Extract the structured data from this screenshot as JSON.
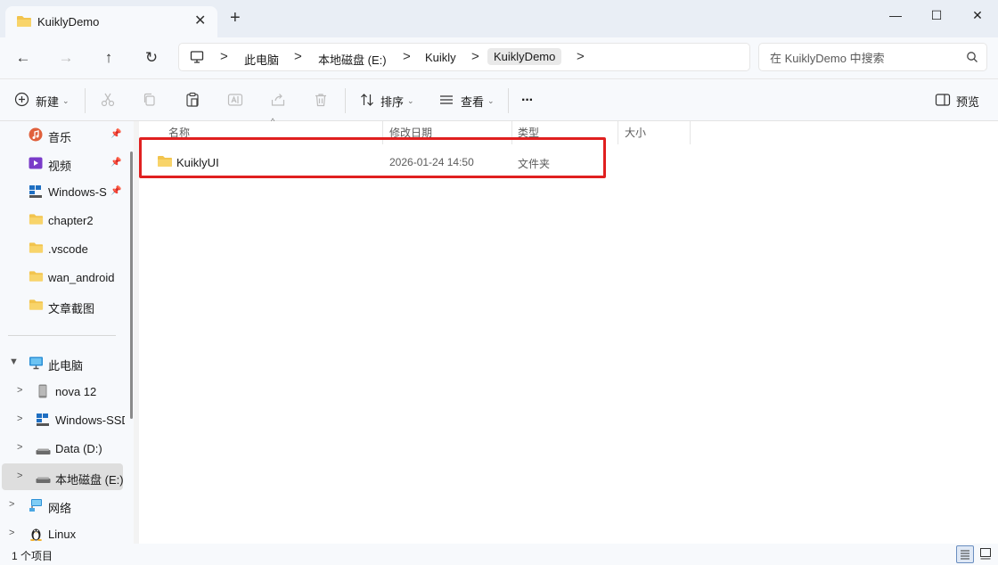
{
  "window": {
    "tab_title": "KuiklyDemo",
    "tab_close": "✕",
    "new_tab": "+",
    "minimize": "—",
    "maximize": "☐",
    "close": "✕"
  },
  "nav": {
    "back": "←",
    "forward": "→",
    "up": "↑",
    "refresh": "↻",
    "breadcrumbs": [
      "此电脑",
      "本地磁盘 (E:)",
      "Kuikly",
      "KuiklyDemo"
    ],
    "separator": ">"
  },
  "search": {
    "placeholder": "在 KuiklyDemo 中搜索"
  },
  "toolbar": {
    "new_label": "新建",
    "sort_label": "排序",
    "view_label": "查看",
    "more_label": "···",
    "preview_label": "预览"
  },
  "sidebar": {
    "quick_access": [
      {
        "label": "音乐",
        "icon": "music-icon",
        "pinned": true
      },
      {
        "label": "视频",
        "icon": "video-icon",
        "pinned": true
      },
      {
        "label": "Windows-SSD",
        "icon": "windows-drive-icon",
        "pinned": true
      },
      {
        "label": "chapter2",
        "icon": "folder-icon"
      },
      {
        "label": ".vscode",
        "icon": "folder-icon"
      },
      {
        "label": "wan_android",
        "icon": "folder-icon"
      },
      {
        "label": "文章截图",
        "icon": "folder-icon"
      }
    ],
    "this_pc": {
      "label": "此电脑",
      "icon": "computer-icon"
    },
    "drives": [
      {
        "label": "nova 12",
        "icon": "phone-icon"
      },
      {
        "label": "Windows-SSD",
        "icon": "windows-drive-icon"
      },
      {
        "label": "Data (D:)",
        "icon": "drive-icon"
      },
      {
        "label": "本地磁盘 (E:)",
        "icon": "drive-icon",
        "selected": true
      }
    ],
    "network": {
      "label": "网络",
      "icon": "network-icon"
    },
    "linux": {
      "label": "Linux",
      "icon": "linux-icon"
    }
  },
  "columns": {
    "name": "名称",
    "modified": "修改日期",
    "type": "类型",
    "size": "大小"
  },
  "files": [
    {
      "name": "KuiklyUI",
      "modified": "2026-01-24 14:50",
      "type": "文件夹",
      "size": ""
    }
  ],
  "status": {
    "count_text": "1 个项目"
  },
  "colors": {
    "accent": "#0067c0",
    "folder": "#f2c44e",
    "highlight_box": "#e02020"
  }
}
